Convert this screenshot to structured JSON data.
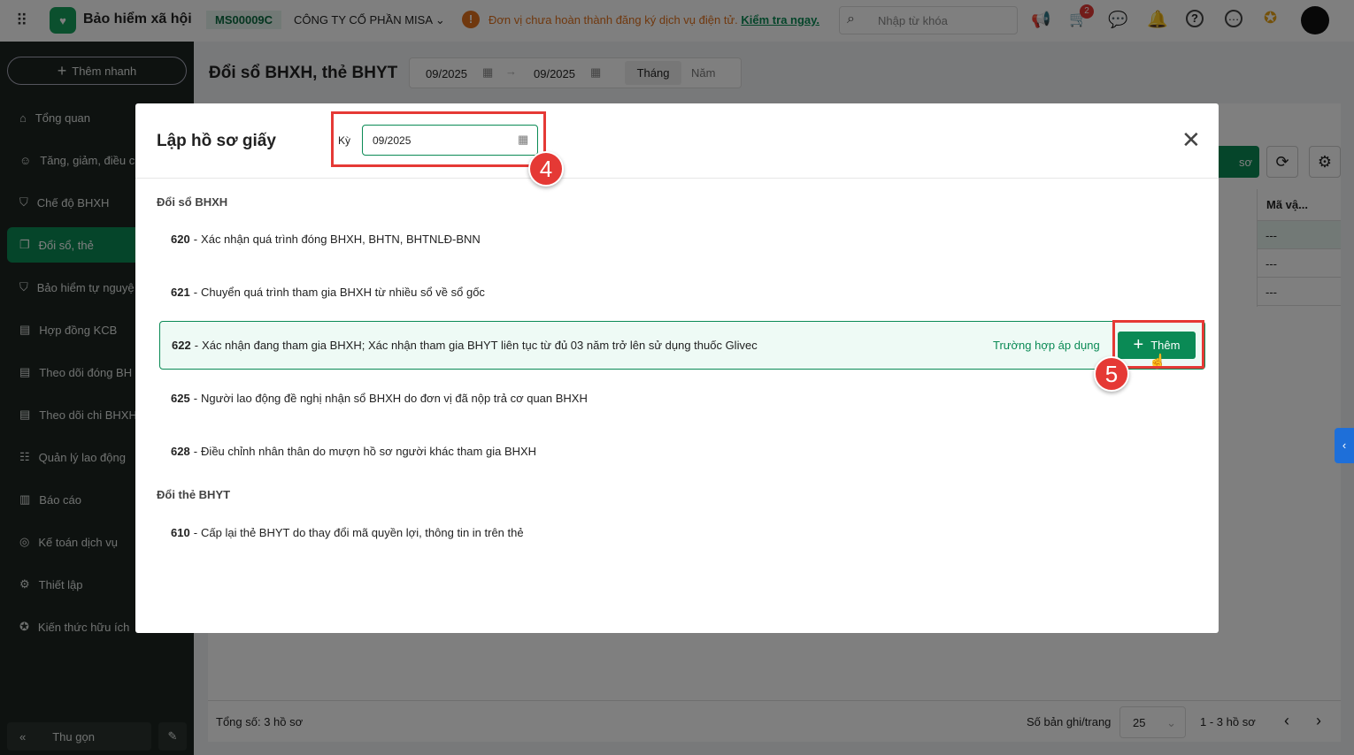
{
  "header": {
    "app_title": "Bảo hiểm xã hội",
    "company_code": "MS00009C",
    "company_name": "CÔNG TY CỔ PHẦN MISA",
    "warning_text": "Đơn vị chưa hoàn thành đăng ký dịch vụ điện tử.",
    "warning_link": "Kiểm tra ngay.",
    "search_placeholder": "Nhập từ khóa",
    "cart_badge": "2"
  },
  "sidebar": {
    "quick_add": "Thêm nhanh",
    "items": [
      {
        "label": "Tổng quan",
        "icon": "home-icon"
      },
      {
        "label": "Tăng, giảm, điều c",
        "icon": "user-icon"
      },
      {
        "label": "Chế độ BHXH",
        "icon": "shield-icon"
      },
      {
        "label": "Đổi sổ, thẻ",
        "icon": "copy-icon",
        "active": true
      },
      {
        "label": "Bảo hiểm tự nguyệ",
        "icon": "shield-icon"
      },
      {
        "label": "Hợp đồng KCB",
        "icon": "document-icon"
      },
      {
        "label": "Theo dõi đóng BH",
        "icon": "document-icon"
      },
      {
        "label": "Theo dõi chi BHXH",
        "icon": "document-icon"
      },
      {
        "label": "Quản lý lao động",
        "icon": "users-icon"
      },
      {
        "label": "Báo cáo",
        "icon": "report-icon"
      },
      {
        "label": "Kế toán dịch vụ",
        "icon": "accounting-icon"
      },
      {
        "label": "Thiết lập",
        "icon": "gear-icon"
      },
      {
        "label": "Kiến thức hữu ích",
        "icon": "bulb-icon"
      }
    ],
    "collapse": "Thu gọn"
  },
  "page": {
    "title": "Đổi sổ BHXH, thẻ BHYT",
    "from": "09/2025",
    "to": "09/2025",
    "tab_month": "Tháng",
    "tab_year": "Năm",
    "button_partial": "sơ",
    "column": "Mã vậ...",
    "cells": [
      "---",
      "---",
      "---"
    ],
    "total": "Tổng số: 3 hồ sơ",
    "per_page_label": "Số bản ghi/trang",
    "per_page": "25",
    "range": "1 - 3 hồ sơ"
  },
  "modal": {
    "title": "Lập hồ sơ giấy",
    "period_label": "Kỳ",
    "period_value": "09/2025",
    "section1": "Đổi sổ BHXH",
    "items1": [
      {
        "code": "620",
        "text": "Xác nhận quá trình đóng BHXH, BHTN, BHTNLĐ-BNN"
      },
      {
        "code": "621",
        "text": "Chuyển quá trình tham gia BHXH từ nhiều sổ về sổ gốc"
      },
      {
        "code": "622",
        "text": "Xác nhận đang tham gia BHXH; Xác nhận tham gia BHYT liên tục từ đủ 03 năm trở lên sử dụng thuốc Glivec"
      },
      {
        "code": "625",
        "text": "Người lao động đề nghị nhận sổ BHXH do đơn vị đã nộp trả cơ quan BHXH"
      },
      {
        "code": "628",
        "text": "Điều chỉnh nhân thân do mượn hồ sơ người khác tham gia BHXH"
      }
    ],
    "section2": "Đổi thẻ BHYT",
    "items2": [
      {
        "code": "610",
        "text": "Cấp lại thẻ BHYT do thay đổi mã quyền lợi, thông tin in trên thẻ"
      }
    ],
    "applicable_link": "Trường hợp áp dụng",
    "add_button": "Thêm"
  },
  "annotations": {
    "step4": "4",
    "step5": "5"
  },
  "colors": {
    "primary": "#0a8a55",
    "annotation": "#e53935",
    "warning": "#e0701c"
  }
}
